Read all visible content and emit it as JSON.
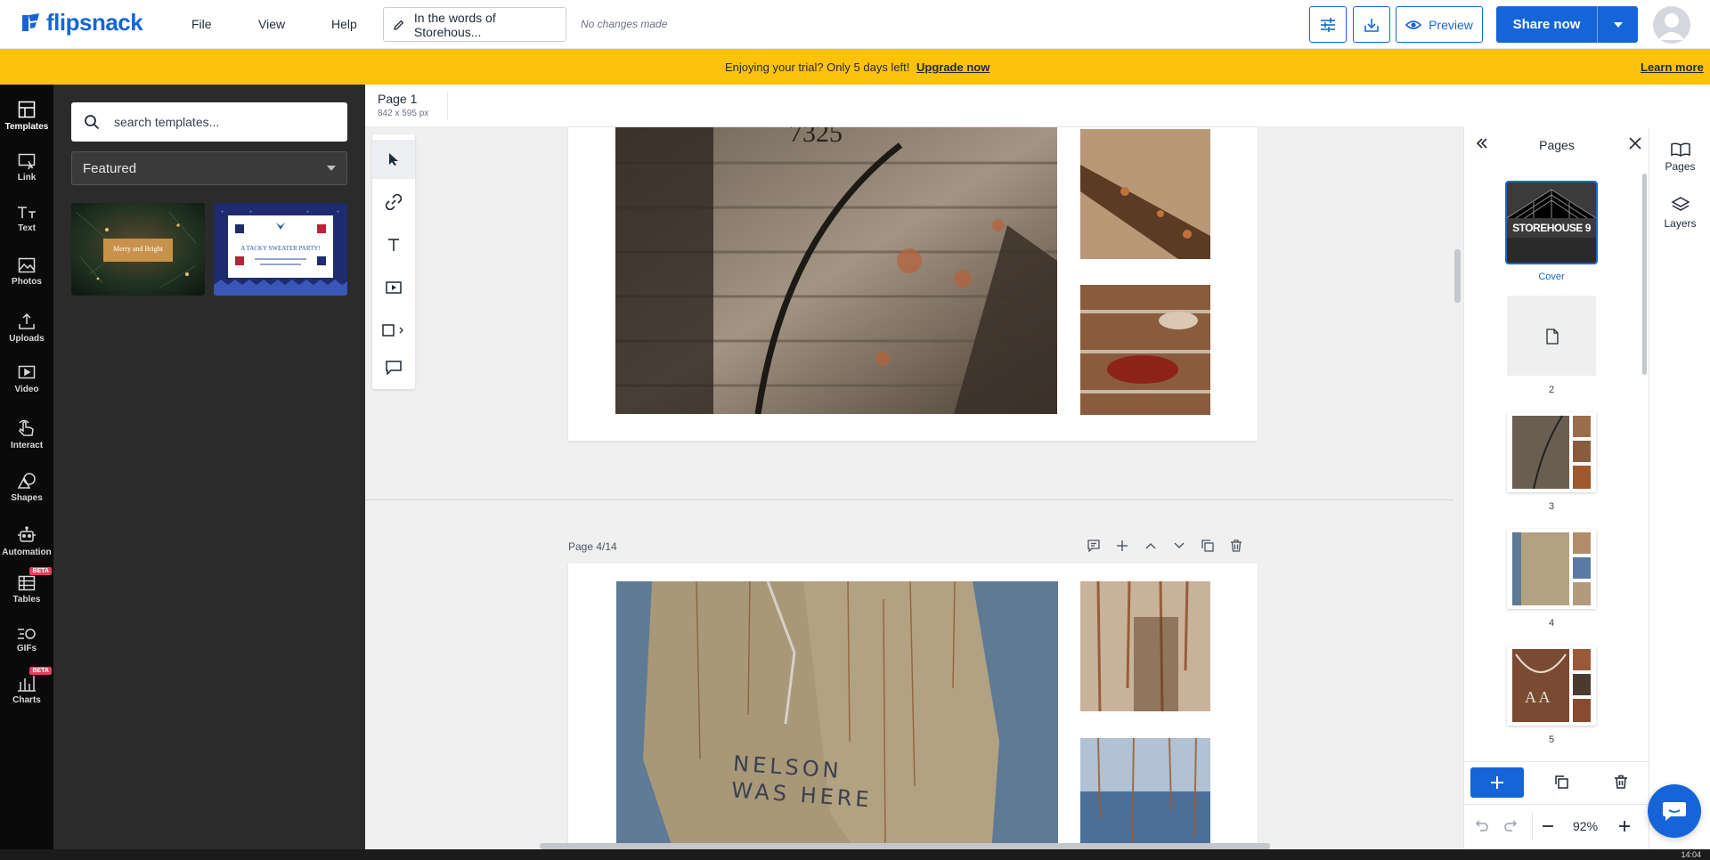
{
  "app": {
    "logo_text": "flipsnack",
    "menu": [
      "File",
      "View",
      "Help"
    ],
    "doc_title": "In the words of Storehous...",
    "save_status": "No changes made",
    "preview_label": "Preview",
    "share_label": "Share now"
  },
  "banner": {
    "message": "Enjoying your trial? Only 5 days left!",
    "upgrade": "Upgrade now",
    "learn_more": "Learn more"
  },
  "rail": [
    {
      "label": "Templates",
      "icon": "templates-icon",
      "active": true
    },
    {
      "label": "Link",
      "icon": "link-icon"
    },
    {
      "label": "Text",
      "icon": "text-icon"
    },
    {
      "label": "Photos",
      "icon": "photos-icon"
    },
    {
      "label": "Uploads",
      "icon": "uploads-icon"
    },
    {
      "label": "Video",
      "icon": "video-icon"
    },
    {
      "label": "Interact",
      "icon": "interact-icon"
    },
    {
      "label": "Shapes",
      "icon": "shapes-icon"
    },
    {
      "label": "Automation",
      "icon": "automation-icon"
    },
    {
      "label": "Tables",
      "icon": "tables-icon",
      "badge": "BETA"
    },
    {
      "label": "GIFs",
      "icon": "gifs-icon"
    },
    {
      "label": "Charts",
      "icon": "charts-icon",
      "badge": "BETA"
    }
  ],
  "templates_panel": {
    "search_placeholder": "search templates...",
    "filter_value": "Featured",
    "templates": [
      {
        "caption": "Merry and Bright"
      },
      {
        "caption": "A TACKY SWEATER PARTY!"
      }
    ]
  },
  "canvas": {
    "page_title": "Page 1",
    "page_size": "842 x 595 px",
    "current_page_label": "Page 4/14",
    "graffiti_text": "NELSON\nWAS HERE"
  },
  "pages_panel": {
    "title": "Pages",
    "thumbnails": [
      {
        "label": "Cover",
        "cover_text": "STOREHOUSE 9",
        "selected": true
      },
      {
        "label": "2"
      },
      {
        "label": "3"
      },
      {
        "label": "4"
      },
      {
        "label": "5"
      }
    ],
    "zoom": "92%"
  },
  "right_rail": [
    {
      "label": "Pages",
      "icon": "book-icon"
    },
    {
      "label": "Layers",
      "icon": "layers-icon"
    }
  ],
  "taskbar": {
    "time": "14:04"
  },
  "colors": {
    "brand": "#1565d8",
    "banner": "#fdc20a",
    "rail": "#0a0a0a",
    "panel": "#2b2b2b"
  }
}
